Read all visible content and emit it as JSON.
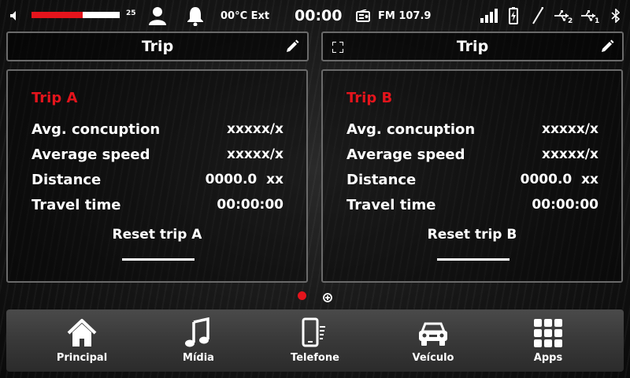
{
  "status_bar": {
    "volume_level": 0.58,
    "volume_value": "25",
    "temperature": "00°C Ext",
    "clock": "00:00",
    "radio": "FM 107.9",
    "usb1_label": "2",
    "usb2_label": "1",
    "icons": [
      "speaker-icon",
      "user-icon",
      "bell-icon",
      "radio-icon",
      "signal-icon",
      "battery-icon",
      "antenna-icon",
      "usb-icon",
      "usb-icon",
      "bluetooth-icon"
    ]
  },
  "panels": [
    {
      "header": "Trip",
      "trip_name": "Trip A",
      "rows": [
        {
          "label": "Avg. concuption",
          "value": "xxxxx/x"
        },
        {
          "label": "Average speed",
          "value": "xxxxx/x"
        },
        {
          "label": "Distance",
          "value": "0000.0  xx"
        },
        {
          "label": "Travel time",
          "value": "00:00:00"
        }
      ],
      "reset": "Reset trip A"
    },
    {
      "header": "Trip",
      "trip_name": "Trip B",
      "rows": [
        {
          "label": "Avg. concuption",
          "value": "xxxxx/x"
        },
        {
          "label": "Average speed",
          "value": "xxxxx/x"
        },
        {
          "label": "Distance",
          "value": "0000.0  xx"
        },
        {
          "label": "Travel time",
          "value": "00:00:00"
        }
      ],
      "reset": "Reset trip B"
    }
  ],
  "nav": [
    {
      "label": "Principal",
      "icon": "home-icon"
    },
    {
      "label": "Mídia",
      "icon": "music-icon"
    },
    {
      "label": "Telefone",
      "icon": "phone-icon"
    },
    {
      "label": "Veículo",
      "icon": "car-icon"
    },
    {
      "label": "Apps",
      "icon": "apps-grid-icon"
    }
  ],
  "colors": {
    "accent": "#e4141c",
    "text": "#ffffff"
  }
}
